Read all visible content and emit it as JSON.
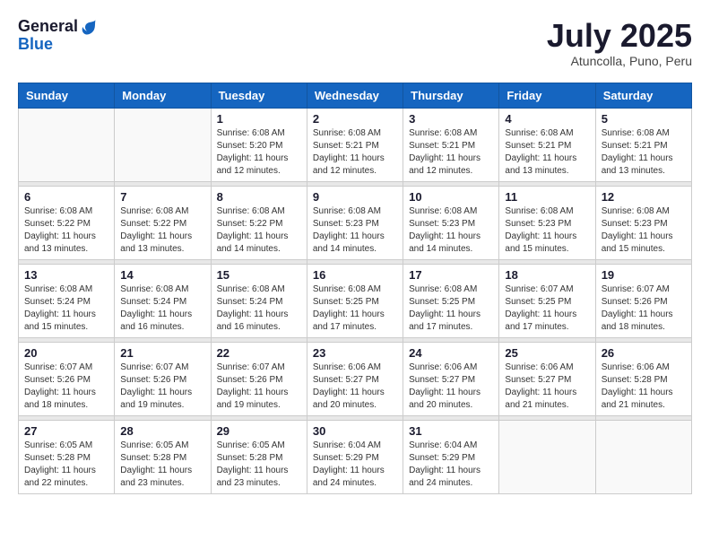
{
  "header": {
    "logo_general": "General",
    "logo_blue": "Blue",
    "month": "July 2025",
    "location": "Atuncolla, Puno, Peru"
  },
  "weekdays": [
    "Sunday",
    "Monday",
    "Tuesday",
    "Wednesday",
    "Thursday",
    "Friday",
    "Saturday"
  ],
  "weeks": [
    [
      {
        "day": "",
        "sunrise": "",
        "sunset": "",
        "daylight": ""
      },
      {
        "day": "",
        "sunrise": "",
        "sunset": "",
        "daylight": ""
      },
      {
        "day": "1",
        "sunrise": "Sunrise: 6:08 AM",
        "sunset": "Sunset: 5:20 PM",
        "daylight": "Daylight: 11 hours and 12 minutes."
      },
      {
        "day": "2",
        "sunrise": "Sunrise: 6:08 AM",
        "sunset": "Sunset: 5:21 PM",
        "daylight": "Daylight: 11 hours and 12 minutes."
      },
      {
        "day": "3",
        "sunrise": "Sunrise: 6:08 AM",
        "sunset": "Sunset: 5:21 PM",
        "daylight": "Daylight: 11 hours and 12 minutes."
      },
      {
        "day": "4",
        "sunrise": "Sunrise: 6:08 AM",
        "sunset": "Sunset: 5:21 PM",
        "daylight": "Daylight: 11 hours and 13 minutes."
      },
      {
        "day": "5",
        "sunrise": "Sunrise: 6:08 AM",
        "sunset": "Sunset: 5:21 PM",
        "daylight": "Daylight: 11 hours and 13 minutes."
      }
    ],
    [
      {
        "day": "6",
        "sunrise": "Sunrise: 6:08 AM",
        "sunset": "Sunset: 5:22 PM",
        "daylight": "Daylight: 11 hours and 13 minutes."
      },
      {
        "day": "7",
        "sunrise": "Sunrise: 6:08 AM",
        "sunset": "Sunset: 5:22 PM",
        "daylight": "Daylight: 11 hours and 13 minutes."
      },
      {
        "day": "8",
        "sunrise": "Sunrise: 6:08 AM",
        "sunset": "Sunset: 5:22 PM",
        "daylight": "Daylight: 11 hours and 14 minutes."
      },
      {
        "day": "9",
        "sunrise": "Sunrise: 6:08 AM",
        "sunset": "Sunset: 5:23 PM",
        "daylight": "Daylight: 11 hours and 14 minutes."
      },
      {
        "day": "10",
        "sunrise": "Sunrise: 6:08 AM",
        "sunset": "Sunset: 5:23 PM",
        "daylight": "Daylight: 11 hours and 14 minutes."
      },
      {
        "day": "11",
        "sunrise": "Sunrise: 6:08 AM",
        "sunset": "Sunset: 5:23 PM",
        "daylight": "Daylight: 11 hours and 15 minutes."
      },
      {
        "day": "12",
        "sunrise": "Sunrise: 6:08 AM",
        "sunset": "Sunset: 5:23 PM",
        "daylight": "Daylight: 11 hours and 15 minutes."
      }
    ],
    [
      {
        "day": "13",
        "sunrise": "Sunrise: 6:08 AM",
        "sunset": "Sunset: 5:24 PM",
        "daylight": "Daylight: 11 hours and 15 minutes."
      },
      {
        "day": "14",
        "sunrise": "Sunrise: 6:08 AM",
        "sunset": "Sunset: 5:24 PM",
        "daylight": "Daylight: 11 hours and 16 minutes."
      },
      {
        "day": "15",
        "sunrise": "Sunrise: 6:08 AM",
        "sunset": "Sunset: 5:24 PM",
        "daylight": "Daylight: 11 hours and 16 minutes."
      },
      {
        "day": "16",
        "sunrise": "Sunrise: 6:08 AM",
        "sunset": "Sunset: 5:25 PM",
        "daylight": "Daylight: 11 hours and 17 minutes."
      },
      {
        "day": "17",
        "sunrise": "Sunrise: 6:08 AM",
        "sunset": "Sunset: 5:25 PM",
        "daylight": "Daylight: 11 hours and 17 minutes."
      },
      {
        "day": "18",
        "sunrise": "Sunrise: 6:07 AM",
        "sunset": "Sunset: 5:25 PM",
        "daylight": "Daylight: 11 hours and 17 minutes."
      },
      {
        "day": "19",
        "sunrise": "Sunrise: 6:07 AM",
        "sunset": "Sunset: 5:26 PM",
        "daylight": "Daylight: 11 hours and 18 minutes."
      }
    ],
    [
      {
        "day": "20",
        "sunrise": "Sunrise: 6:07 AM",
        "sunset": "Sunset: 5:26 PM",
        "daylight": "Daylight: 11 hours and 18 minutes."
      },
      {
        "day": "21",
        "sunrise": "Sunrise: 6:07 AM",
        "sunset": "Sunset: 5:26 PM",
        "daylight": "Daylight: 11 hours and 19 minutes."
      },
      {
        "day": "22",
        "sunrise": "Sunrise: 6:07 AM",
        "sunset": "Sunset: 5:26 PM",
        "daylight": "Daylight: 11 hours and 19 minutes."
      },
      {
        "day": "23",
        "sunrise": "Sunrise: 6:06 AM",
        "sunset": "Sunset: 5:27 PM",
        "daylight": "Daylight: 11 hours and 20 minutes."
      },
      {
        "day": "24",
        "sunrise": "Sunrise: 6:06 AM",
        "sunset": "Sunset: 5:27 PM",
        "daylight": "Daylight: 11 hours and 20 minutes."
      },
      {
        "day": "25",
        "sunrise": "Sunrise: 6:06 AM",
        "sunset": "Sunset: 5:27 PM",
        "daylight": "Daylight: 11 hours and 21 minutes."
      },
      {
        "day": "26",
        "sunrise": "Sunrise: 6:06 AM",
        "sunset": "Sunset: 5:28 PM",
        "daylight": "Daylight: 11 hours and 21 minutes."
      }
    ],
    [
      {
        "day": "27",
        "sunrise": "Sunrise: 6:05 AM",
        "sunset": "Sunset: 5:28 PM",
        "daylight": "Daylight: 11 hours and 22 minutes."
      },
      {
        "day": "28",
        "sunrise": "Sunrise: 6:05 AM",
        "sunset": "Sunset: 5:28 PM",
        "daylight": "Daylight: 11 hours and 23 minutes."
      },
      {
        "day": "29",
        "sunrise": "Sunrise: 6:05 AM",
        "sunset": "Sunset: 5:28 PM",
        "daylight": "Daylight: 11 hours and 23 minutes."
      },
      {
        "day": "30",
        "sunrise": "Sunrise: 6:04 AM",
        "sunset": "Sunset: 5:29 PM",
        "daylight": "Daylight: 11 hours and 24 minutes."
      },
      {
        "day": "31",
        "sunrise": "Sunrise: 6:04 AM",
        "sunset": "Sunset: 5:29 PM",
        "daylight": "Daylight: 11 hours and 24 minutes."
      },
      {
        "day": "",
        "sunrise": "",
        "sunset": "",
        "daylight": ""
      },
      {
        "day": "",
        "sunrise": "",
        "sunset": "",
        "daylight": ""
      }
    ]
  ]
}
